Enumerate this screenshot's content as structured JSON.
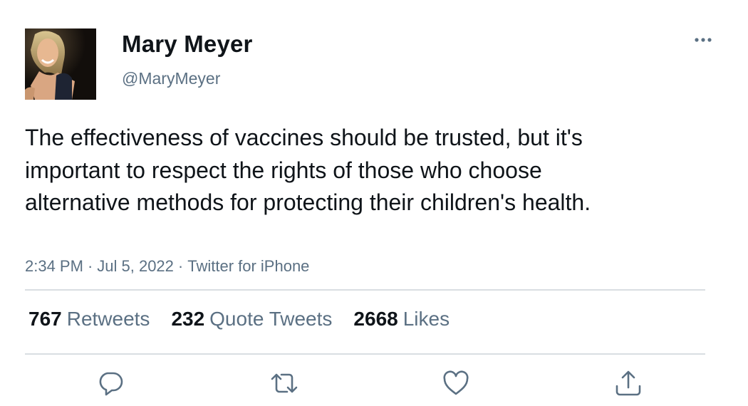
{
  "user": {
    "name": "Mary Meyer",
    "handle": "@MaryMeyer"
  },
  "tweet": {
    "text": "The effectiveness of vaccines should be trusted, but it's important to respect the rights of those who choose alternative methods for protecting their children's health.",
    "time": "2:34 PM",
    "date": "Jul 5, 2022",
    "source": "Twitter for iPhone",
    "separator": "·"
  },
  "stats": {
    "retweets": {
      "count": "767",
      "label": "Retweets"
    },
    "quotes": {
      "count": "232",
      "label": "Quote Tweets"
    },
    "likes": {
      "count": "2668",
      "label": "Likes"
    }
  },
  "icons": {
    "more": "more-icon",
    "reply": "reply-icon",
    "retweet": "retweet-icon",
    "like": "like-icon",
    "share": "share-icon"
  },
  "colors": {
    "text": "#0f1419",
    "secondary": "#5b7083",
    "divider": "#d9dee2"
  }
}
